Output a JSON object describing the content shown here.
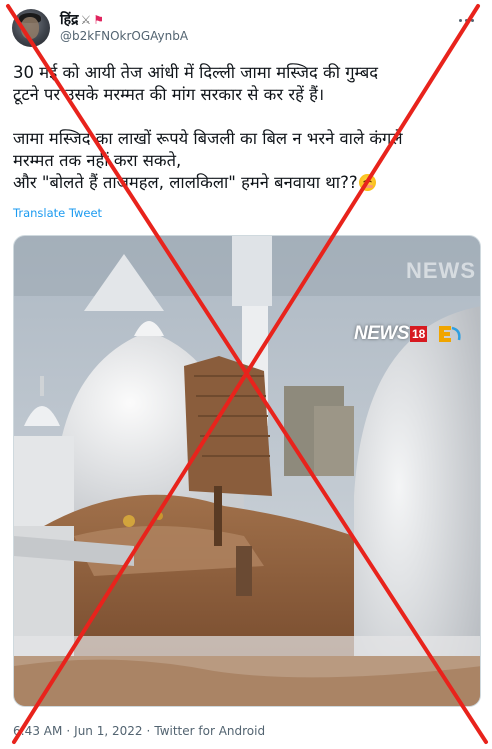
{
  "author": {
    "display_name": "हिंद्र",
    "handle": "@b2kFNOkrOGAynbA",
    "badge_icons": [
      "crossed-swords-icon",
      "red-flag-icon"
    ]
  },
  "tweet": {
    "paragraph_1": {
      "line_1": "30 मई को आयी तेज आंधी में दिल्ली जामा मस्जिद की गुम्बद",
      "line_2": "टूटने पर उसके मरम्मत की मांग सरकार से कर रहें हैं।"
    },
    "paragraph_2": {
      "line_1": "जामा मस्जिद का लाखों रूपये बिजली का बिल न भरने वाले कंगले",
      "line_2": "मरम्मत तक नहीं करा सकते,",
      "line_3": "और \"बोलते हैं ताजमहल, लालकिला\" हमने बनवाया था??",
      "emoji": "smiling-face-icon"
    },
    "translate_label": "Translate Tweet"
  },
  "media": {
    "description_icon": "damaged-mosque-dome-photo",
    "channel_logo_text": "NEWS",
    "channel_logo_number": "18",
    "watermark_text": "NEWS"
  },
  "meta": {
    "time": "6:43 AM",
    "separator": "·",
    "date": "Jun 1, 2022",
    "source": "Twitter for Android"
  },
  "overlay": {
    "type": "red-cross-out",
    "color": "#e8231c"
  }
}
